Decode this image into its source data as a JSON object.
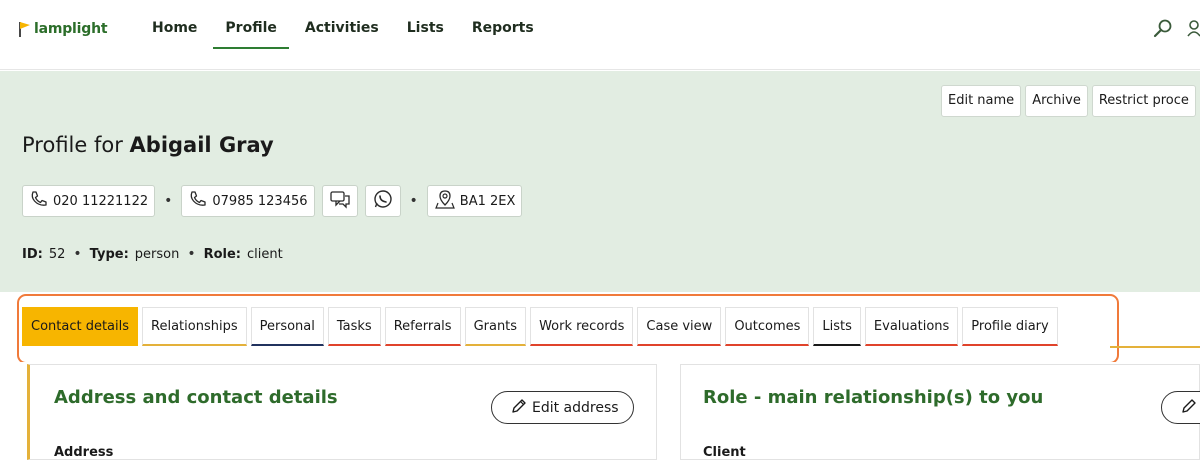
{
  "brand": {
    "logo_text": "lamplight"
  },
  "nav": {
    "items": [
      {
        "label": "Home"
      },
      {
        "label": "Profile"
      },
      {
        "label": "Activities"
      },
      {
        "label": "Lists"
      },
      {
        "label": "Reports"
      }
    ],
    "active_index": 1
  },
  "header": {
    "actions": [
      {
        "label": "Edit name"
      },
      {
        "label": "Archive"
      },
      {
        "label": "Restrict proce"
      }
    ],
    "title_prefix": "Profile for",
    "title_name": "Abigail Gray",
    "contacts": {
      "phone1": "020 11221122",
      "phone2": "07985 123456",
      "postcode": "BA1 2EX"
    },
    "meta": {
      "id_label": "ID:",
      "id_value": "52",
      "type_label": "Type:",
      "type_value": "person",
      "role_label": "Role:",
      "role_value": "client"
    }
  },
  "tabs": [
    {
      "label": "Contact details",
      "underline": "active"
    },
    {
      "label": "Relationships",
      "underline": "gold"
    },
    {
      "label": "Personal",
      "underline": "navy"
    },
    {
      "label": "Tasks",
      "underline": "red"
    },
    {
      "label": "Referrals",
      "underline": "red"
    },
    {
      "label": "Grants",
      "underline": "gold"
    },
    {
      "label": "Work records",
      "underline": "red"
    },
    {
      "label": "Case view",
      "underline": "red"
    },
    {
      "label": "Outcomes",
      "underline": "red"
    },
    {
      "label": "Lists",
      "underline": "dark"
    },
    {
      "label": "Evaluations",
      "underline": "red"
    },
    {
      "label": "Profile diary",
      "underline": "red"
    }
  ],
  "panels": {
    "left": {
      "title": "Address and contact details",
      "button": "Edit address",
      "sub": "Address"
    },
    "right": {
      "title": "Role - main relationship(s) to you",
      "button": "",
      "sub": "Client"
    }
  },
  "colors": {
    "accent_green": "#2e7d32",
    "header_bg": "#e2ede2",
    "tab_active": "#f7b500",
    "highlight_outline": "#f07a3a"
  }
}
